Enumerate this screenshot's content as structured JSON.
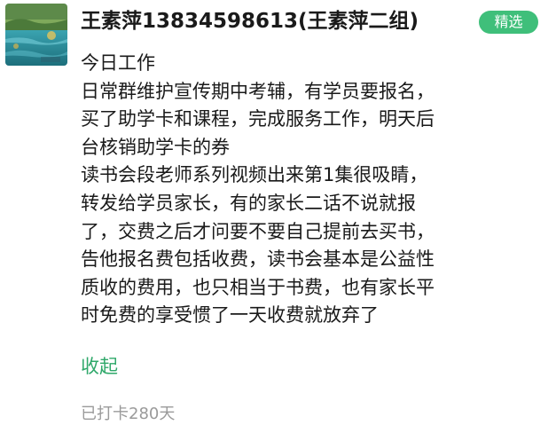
{
  "author": {
    "name": "王素萍13834598613(王素萍二组)"
  },
  "badge": {
    "label": "精选",
    "color": "#3fbf7a"
  },
  "content": {
    "lines": [
      "今日工作",
      "日常群维护宣传期中考辅，有学员要报名，",
      "买了助学卡和课程，完成服务工作，明天后",
      "台核销助学卡的券",
      "读书会段老师系列视频出来第1集很吸睛，",
      "转发给学员家长，有的家长二话不说就报",
      "了，交费之后才问要不要自己提前去买书，",
      "告他报名费包括收费，读书会基本是公益性",
      "质收的费用，也只相当于书费，也有家长平",
      "时免费的享受惯了一天收费就放弃了"
    ]
  },
  "actions": {
    "collapse_label": "收起",
    "collapse_color": "#2fa86a"
  },
  "stats": {
    "checkin_label": "已打卡280天"
  }
}
